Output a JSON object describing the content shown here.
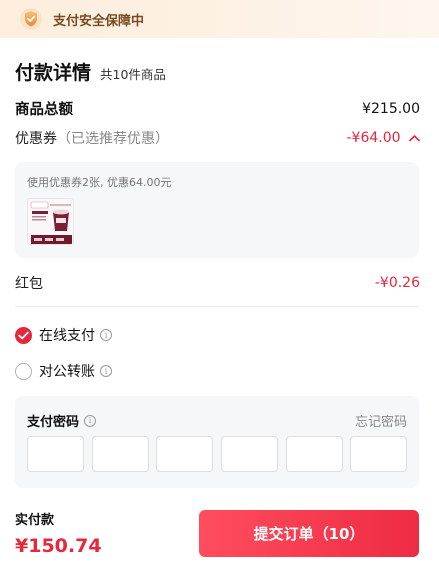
{
  "topbar": {
    "text": "支付安全保障中"
  },
  "details": {
    "title": "付款详情",
    "item_count": "共10件商品"
  },
  "total_row": {
    "label": "商品总额",
    "value": "¥215.00"
  },
  "coupon_row": {
    "label": "优惠券",
    "hint": "（已选推荐优惠）",
    "value": "-¥64.00"
  },
  "coupon_box": {
    "note": "使用优惠券2张, 优惠64.00元"
  },
  "red_packet": {
    "label": "红包",
    "value": "-¥0.26"
  },
  "payment": {
    "online": {
      "label": "在线支付",
      "selected": true
    },
    "corporate": {
      "label": "对公转账",
      "selected": false
    }
  },
  "password": {
    "title": "支付密码",
    "forgot": "忘记密码",
    "cells": 6
  },
  "footer": {
    "label": "实付款",
    "amount": "¥150.74",
    "submit": "提交订单（10）"
  },
  "colors": {
    "accent": "#e5283c",
    "topbar_bg": "#fdeedd",
    "panel_bg": "#f6f7f9"
  }
}
